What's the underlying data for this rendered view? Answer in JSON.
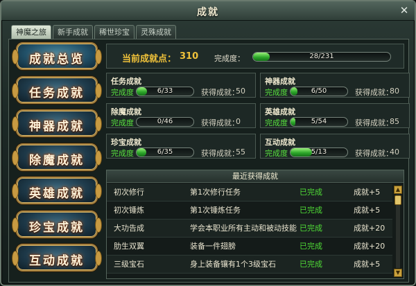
{
  "window": {
    "title": "成就",
    "close_label": "✕"
  },
  "tabs": [
    {
      "label": "神魔之旅",
      "active": true
    },
    {
      "label": "新手成就",
      "active": false
    },
    {
      "label": "稀世珍宝",
      "active": false
    },
    {
      "label": "灵殊成就",
      "active": false
    }
  ],
  "sidebar": [
    {
      "label": "成就总览",
      "active": true
    },
    {
      "label": "任务成就",
      "active": false
    },
    {
      "label": "神器成就",
      "active": false
    },
    {
      "label": "除魔成就",
      "active": false
    },
    {
      "label": "英雄成就",
      "active": false
    },
    {
      "label": "珍宝成就",
      "active": false
    },
    {
      "label": "互动成就",
      "active": false
    }
  ],
  "summary": {
    "current_points_label": "当前成就点：",
    "current_points": "310",
    "completion_label": "完成度：",
    "completion_text": "28/231",
    "completion_fraction": 0.121
  },
  "categories": [
    {
      "name": "任务成就",
      "completion_label": "完成度",
      "progress_text": "6/33",
      "progress_fraction": 0.18,
      "earned_label": "获得成就：",
      "earned_value": "50"
    },
    {
      "name": "神器成就",
      "completion_label": "完成度",
      "progress_text": "6/50",
      "progress_fraction": 0.12,
      "earned_label": "获得成就：",
      "earned_value": "80"
    },
    {
      "name": "除魔成就",
      "completion_label": "完成度",
      "progress_text": "0/46",
      "progress_fraction": 0,
      "earned_label": "获得成就：",
      "earned_value": "0"
    },
    {
      "name": "英雄成就",
      "completion_label": "完成度",
      "progress_text": "5/54",
      "progress_fraction": 0.09,
      "earned_label": "获得成就：",
      "earned_value": "85"
    },
    {
      "name": "珍宝成就",
      "completion_label": "完成度",
      "progress_text": "6/35",
      "progress_fraction": 0.17,
      "earned_label": "获得成就：",
      "earned_value": "55"
    },
    {
      "name": "互动成就",
      "completion_label": "完成度",
      "progress_text": "5/13",
      "progress_fraction": 0.38,
      "earned_label": "获得成就：",
      "earned_value": "40"
    }
  ],
  "recent": {
    "title": "最近获得成就",
    "rows": [
      {
        "name": "初次修行",
        "desc": "第1次修行任务",
        "status": "已完成",
        "reward": "成就+5"
      },
      {
        "name": "初次锤炼",
        "desc": "第1次锤炼任务",
        "status": "已完成",
        "reward": "成就+5"
      },
      {
        "name": "大功告成",
        "desc": "学会本职业所有主动和被动技能",
        "status": "已完成",
        "reward": "成就+20"
      },
      {
        "name": "肋生双翼",
        "desc": "装备一件翅膀",
        "status": "已完成",
        "reward": "成就+20"
      },
      {
        "name": "三级宝石",
        "desc": "身上装备镶有1个3级宝石",
        "status": "已完成",
        "reward": "成就+5"
      }
    ]
  },
  "colors": {
    "accent_gold": "#f0c23a",
    "status_green": "#4fdc36",
    "bar_green": "#2ea82b"
  },
  "icons": {
    "close": "close-icon",
    "scroll_up": "arrow-up-icon",
    "scroll_down": "arrow-down-icon"
  }
}
